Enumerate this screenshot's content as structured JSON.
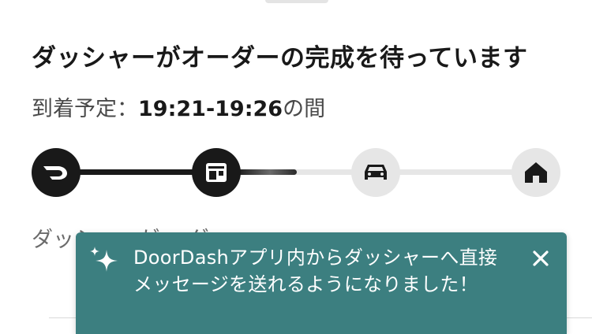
{
  "status": {
    "title": "ダッシャーがオーダーの完成を待っています",
    "eta_label": "到着予定：",
    "eta_time": "19:21-19:26",
    "eta_suffix": "の間"
  },
  "tracker": {
    "steps": [
      {
        "icon": "doordash-logo-icon",
        "state": "done"
      },
      {
        "icon": "store-icon",
        "state": "current"
      },
      {
        "icon": "car-icon",
        "state": "upcoming"
      },
      {
        "icon": "home-icon",
        "state": "upcoming"
      }
    ]
  },
  "description": {
    "text": "ダッシャーが… ダー…"
  },
  "toast": {
    "icon": "sparkle-icon",
    "message": "DoorDashアプリ内からダッシャーへ直接メッセージを送れるようになりました！",
    "close_icon": "close-icon"
  },
  "colors": {
    "toast_bg": "#3c7f80",
    "active_step": "#191919",
    "inactive_step": "#e6e6e6"
  }
}
